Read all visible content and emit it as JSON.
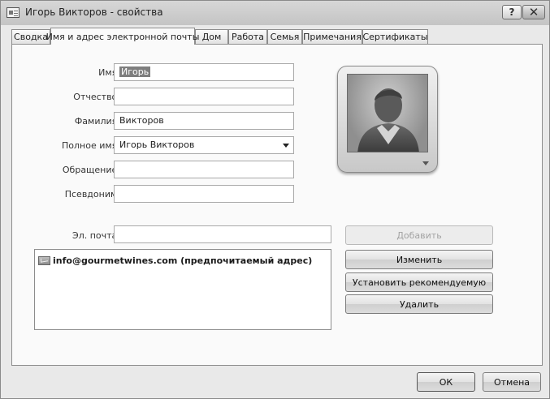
{
  "window": {
    "title": "Игорь Викторов - свойства",
    "help_label": "?",
    "close_label": "✕"
  },
  "tabs": [
    {
      "label": "Сводка",
      "active": false
    },
    {
      "label": "Имя и адрес электронной почты",
      "active": true
    },
    {
      "label": "Дом",
      "active": false
    },
    {
      "label": "Работа",
      "active": false
    },
    {
      "label": "Семья",
      "active": false
    },
    {
      "label": "Примечания",
      "active": false
    },
    {
      "label": "Сертификаты",
      "active": false
    }
  ],
  "form": {
    "first_name": {
      "label": "Имя:",
      "value": "Игорь"
    },
    "middle_name": {
      "label": "Отчество:",
      "value": ""
    },
    "last_name": {
      "label": "Фамилия:",
      "value": "Викторов"
    },
    "full_name": {
      "label": "Полное имя:",
      "value": "Игорь Викторов"
    },
    "salutation": {
      "label": "Обращение:",
      "value": ""
    },
    "nickname": {
      "label": "Псевдоним:",
      "value": ""
    },
    "email": {
      "label": "Эл. почта:",
      "value": ""
    }
  },
  "email_list": {
    "items": [
      {
        "text": "info@gourmetwines.com  (предпочитаемый адрес)"
      }
    ]
  },
  "email_buttons": {
    "add": "Добавить",
    "edit": "Изменить",
    "set_preferred": "Установить рекомендуемую",
    "delete": "Удалить"
  },
  "footer": {
    "ok": "ОК",
    "cancel": "Отмена"
  },
  "colors": {
    "window_bg": "#e9e9e9",
    "panel_bg": "#fafafa",
    "selection": "#7e7e7e"
  },
  "icons": {
    "contact_photo": "person-silhouette-icon",
    "email_entry": "mail-icon"
  }
}
